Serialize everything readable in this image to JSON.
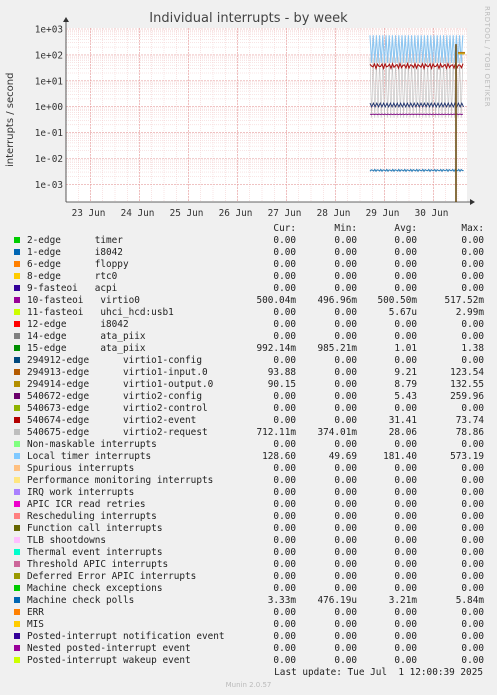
{
  "title": "Individual interrupts - by week",
  "ylabel": "interrupts / second",
  "side_credit": "RRDTOOL / TOBI OETIKER",
  "columns": [
    "Cur:",
    "Min:",
    "Avg:",
    "Max:"
  ],
  "last_update": "Last update: Tue Jul  1 12:00:39 2025",
  "footer": "Munin 2.0.57",
  "chart_data": {
    "type": "line",
    "title": "Individual interrupts - by week",
    "ylabel": "interrupts / second",
    "yscale": "log",
    "ylim": [
      0.0005,
      1000
    ],
    "yticks": [
      "1e+03",
      "1e+02",
      "1e+01",
      "1e+00",
      "1e-01",
      "1e-02",
      "1e-03"
    ],
    "xticks": [
      "23 Jun",
      "24 Jun",
      "25 Jun",
      "26 Jun",
      "27 Jun",
      "28 Jun",
      "29 Jun",
      "30 Jun"
    ],
    "grid": true,
    "series": [
      {
        "name": "Local timer interrupts",
        "color": "#8ec6f0",
        "x": [
          "29 Jun",
          "1 Jul"
        ],
        "low": 49.69,
        "high": 573.19
      },
      {
        "name": "virtio2-request",
        "color": "#bdbdbd",
        "x": [
          "29 Jun",
          "1 Jul"
        ],
        "low": 0.374,
        "high": 78.86
      },
      {
        "name": "virtio2-event",
        "color": "#aa1111",
        "x": [
          "29 Jun",
          "1 Jul"
        ],
        "low": 31.41,
        "high": 73.74
      },
      {
        "name": "virtio1-input.0",
        "color": "#b8770d",
        "x": [
          "1 Jul",
          "1 Jul"
        ],
        "low": 9.21,
        "high": 123.54
      },
      {
        "name": "virtio1-output.0",
        "color": "#c8a000",
        "x": [
          "1 Jul",
          "1 Jul"
        ],
        "low": 8.79,
        "high": 132.55
      },
      {
        "name": "virtio2-config",
        "color": "#6b4c12",
        "x": [
          "1 Jul",
          "1 Jul"
        ],
        "low": 0.0005,
        "high": 259.96
      },
      {
        "name": "10-fasteoi virtio0",
        "color": "#8a1a8a",
        "x": [
          "29 Jun",
          "1 Jul"
        ],
        "low": 0.49696,
        "high": 0.51752
      },
      {
        "name": "15-edge ata_piix",
        "color": "#1a2e6b",
        "x": [
          "29 Jun",
          "1 Jul"
        ],
        "low": 0.98521,
        "high": 1.38
      },
      {
        "name": "Machine check polls",
        "color": "#2f7fb8",
        "x": [
          "29 Jun",
          "1 Jul"
        ],
        "low": 0.00333,
        "high": 0.00384
      }
    ]
  },
  "legend": [
    {
      "color": "#00cc00",
      "name": "2-edge      timer",
      "cur": "0.00",
      "min": "0.00",
      "avg": "0.00",
      "max": "0.00"
    },
    {
      "color": "#0066b3",
      "name": "1-edge      i8042",
      "cur": "0.00",
      "min": "0.00",
      "avg": "0.00",
      "max": "0.00"
    },
    {
      "color": "#ff8000",
      "name": "6-edge      floppy",
      "cur": "0.00",
      "min": "0.00",
      "avg": "0.00",
      "max": "0.00"
    },
    {
      "color": "#ffcc00",
      "name": "8-edge      rtc0",
      "cur": "0.00",
      "min": "0.00",
      "avg": "0.00",
      "max": "0.00"
    },
    {
      "color": "#330099",
      "name": "9-fasteoi   acpi",
      "cur": "0.00",
      "min": "0.00",
      "avg": "0.00",
      "max": "0.00"
    },
    {
      "color": "#990099",
      "name": "10-fasteoi   virtio0",
      "cur": "500.04m",
      "min": "496.96m",
      "avg": "500.50m",
      "max": "517.52m"
    },
    {
      "color": "#ccff00",
      "name": "11-fasteoi   uhci_hcd:usb1",
      "cur": "0.00",
      "min": "0.00",
      "avg": "5.67u",
      "max": "2.99m"
    },
    {
      "color": "#ff0000",
      "name": "12-edge      i8042",
      "cur": "0.00",
      "min": "0.00",
      "avg": "0.00",
      "max": "0.00"
    },
    {
      "color": "#808080",
      "name": "14-edge      ata_piix",
      "cur": "0.00",
      "min": "0.00",
      "avg": "0.00",
      "max": "0.00"
    },
    {
      "color": "#008f00",
      "name": "15-edge      ata_piix",
      "cur": "992.14m",
      "min": "985.21m",
      "avg": "1.01",
      "max": "1.38"
    },
    {
      "color": "#00487d",
      "name": "294912-edge      virtio1-config",
      "cur": "0.00",
      "min": "0.00",
      "avg": "0.00",
      "max": "0.00"
    },
    {
      "color": "#b35a00",
      "name": "294913-edge      virtio1-input.0",
      "cur": "93.88",
      "min": "0.00",
      "avg": "9.21",
      "max": "123.54"
    },
    {
      "color": "#b38f00",
      "name": "294914-edge      virtio1-output.0",
      "cur": "90.15",
      "min": "0.00",
      "avg": "8.79",
      "max": "132.55"
    },
    {
      "color": "#6b006b",
      "name": "540672-edge      virtio2-config",
      "cur": "0.00",
      "min": "0.00",
      "avg": "5.43",
      "max": "259.96"
    },
    {
      "color": "#8fb300",
      "name": "540673-edge      virtio2-control",
      "cur": "0.00",
      "min": "0.00",
      "avg": "0.00",
      "max": "0.00"
    },
    {
      "color": "#b30000",
      "name": "540674-edge      virtio2-event",
      "cur": "0.00",
      "min": "0.00",
      "avg": "31.41",
      "max": "73.74"
    },
    {
      "color": "#bebebe",
      "name": "540675-edge      virtio2-request",
      "cur": "712.11m",
      "min": "374.01m",
      "avg": "28.06",
      "max": "78.86"
    },
    {
      "color": "#80ff80",
      "name": "Non-maskable interrupts",
      "cur": "0.00",
      "min": "0.00",
      "avg": "0.00",
      "max": "0.00"
    },
    {
      "color": "#80c9ff",
      "name": "Local timer interrupts",
      "cur": "128.60",
      "min": "49.69",
      "avg": "181.40",
      "max": "573.19"
    },
    {
      "color": "#ffc080",
      "name": "Spurious interrupts",
      "cur": "0.00",
      "min": "0.00",
      "avg": "0.00",
      "max": "0.00"
    },
    {
      "color": "#ffe680",
      "name": "Performance monitoring interrupts",
      "cur": "0.00",
      "min": "0.00",
      "avg": "0.00",
      "max": "0.00"
    },
    {
      "color": "#aa80ff",
      "name": "IRQ work interrupts",
      "cur": "0.00",
      "min": "0.00",
      "avg": "0.00",
      "max": "0.00"
    },
    {
      "color": "#ee00cc",
      "name": "APIC ICR read retries",
      "cur": "0.00",
      "min": "0.00",
      "avg": "0.00",
      "max": "0.00"
    },
    {
      "color": "#ff8080",
      "name": "Rescheduling interrupts",
      "cur": "0.00",
      "min": "0.00",
      "avg": "0.00",
      "max": "0.00"
    },
    {
      "color": "#666600",
      "name": "Function call interrupts",
      "cur": "0.00",
      "min": "0.00",
      "avg": "0.00",
      "max": "0.00"
    },
    {
      "color": "#ffbfff",
      "name": "TLB shootdowns",
      "cur": "0.00",
      "min": "0.00",
      "avg": "0.00",
      "max": "0.00"
    },
    {
      "color": "#00ffcc",
      "name": "Thermal event interrupts",
      "cur": "0.00",
      "min": "0.00",
      "avg": "0.00",
      "max": "0.00"
    },
    {
      "color": "#cc6699",
      "name": "Threshold APIC interrupts",
      "cur": "0.00",
      "min": "0.00",
      "avg": "0.00",
      "max": "0.00"
    },
    {
      "color": "#999900",
      "name": "Deferred Error APIC interrupts",
      "cur": "0.00",
      "min": "0.00",
      "avg": "0.00",
      "max": "0.00"
    },
    {
      "color": "#00cc00",
      "name": "Machine check exceptions",
      "cur": "0.00",
      "min": "0.00",
      "avg": "0.00",
      "max": "0.00"
    },
    {
      "color": "#0066b3",
      "name": "Machine check polls",
      "cur": "3.33m",
      "min": "476.19u",
      "avg": "3.21m",
      "max": "5.84m"
    },
    {
      "color": "#ff8000",
      "name": "ERR",
      "cur": "0.00",
      "min": "0.00",
      "avg": "0.00",
      "max": "0.00"
    },
    {
      "color": "#ffcc00",
      "name": "MIS",
      "cur": "0.00",
      "min": "0.00",
      "avg": "0.00",
      "max": "0.00"
    },
    {
      "color": "#330099",
      "name": "Posted-interrupt notification event",
      "cur": "0.00",
      "min": "0.00",
      "avg": "0.00",
      "max": "0.00"
    },
    {
      "color": "#990099",
      "name": "Nested posted-interrupt event",
      "cur": "0.00",
      "min": "0.00",
      "avg": "0.00",
      "max": "0.00"
    },
    {
      "color": "#ccff00",
      "name": "Posted-interrupt wakeup event",
      "cur": "0.00",
      "min": "0.00",
      "avg": "0.00",
      "max": "0.00"
    }
  ]
}
